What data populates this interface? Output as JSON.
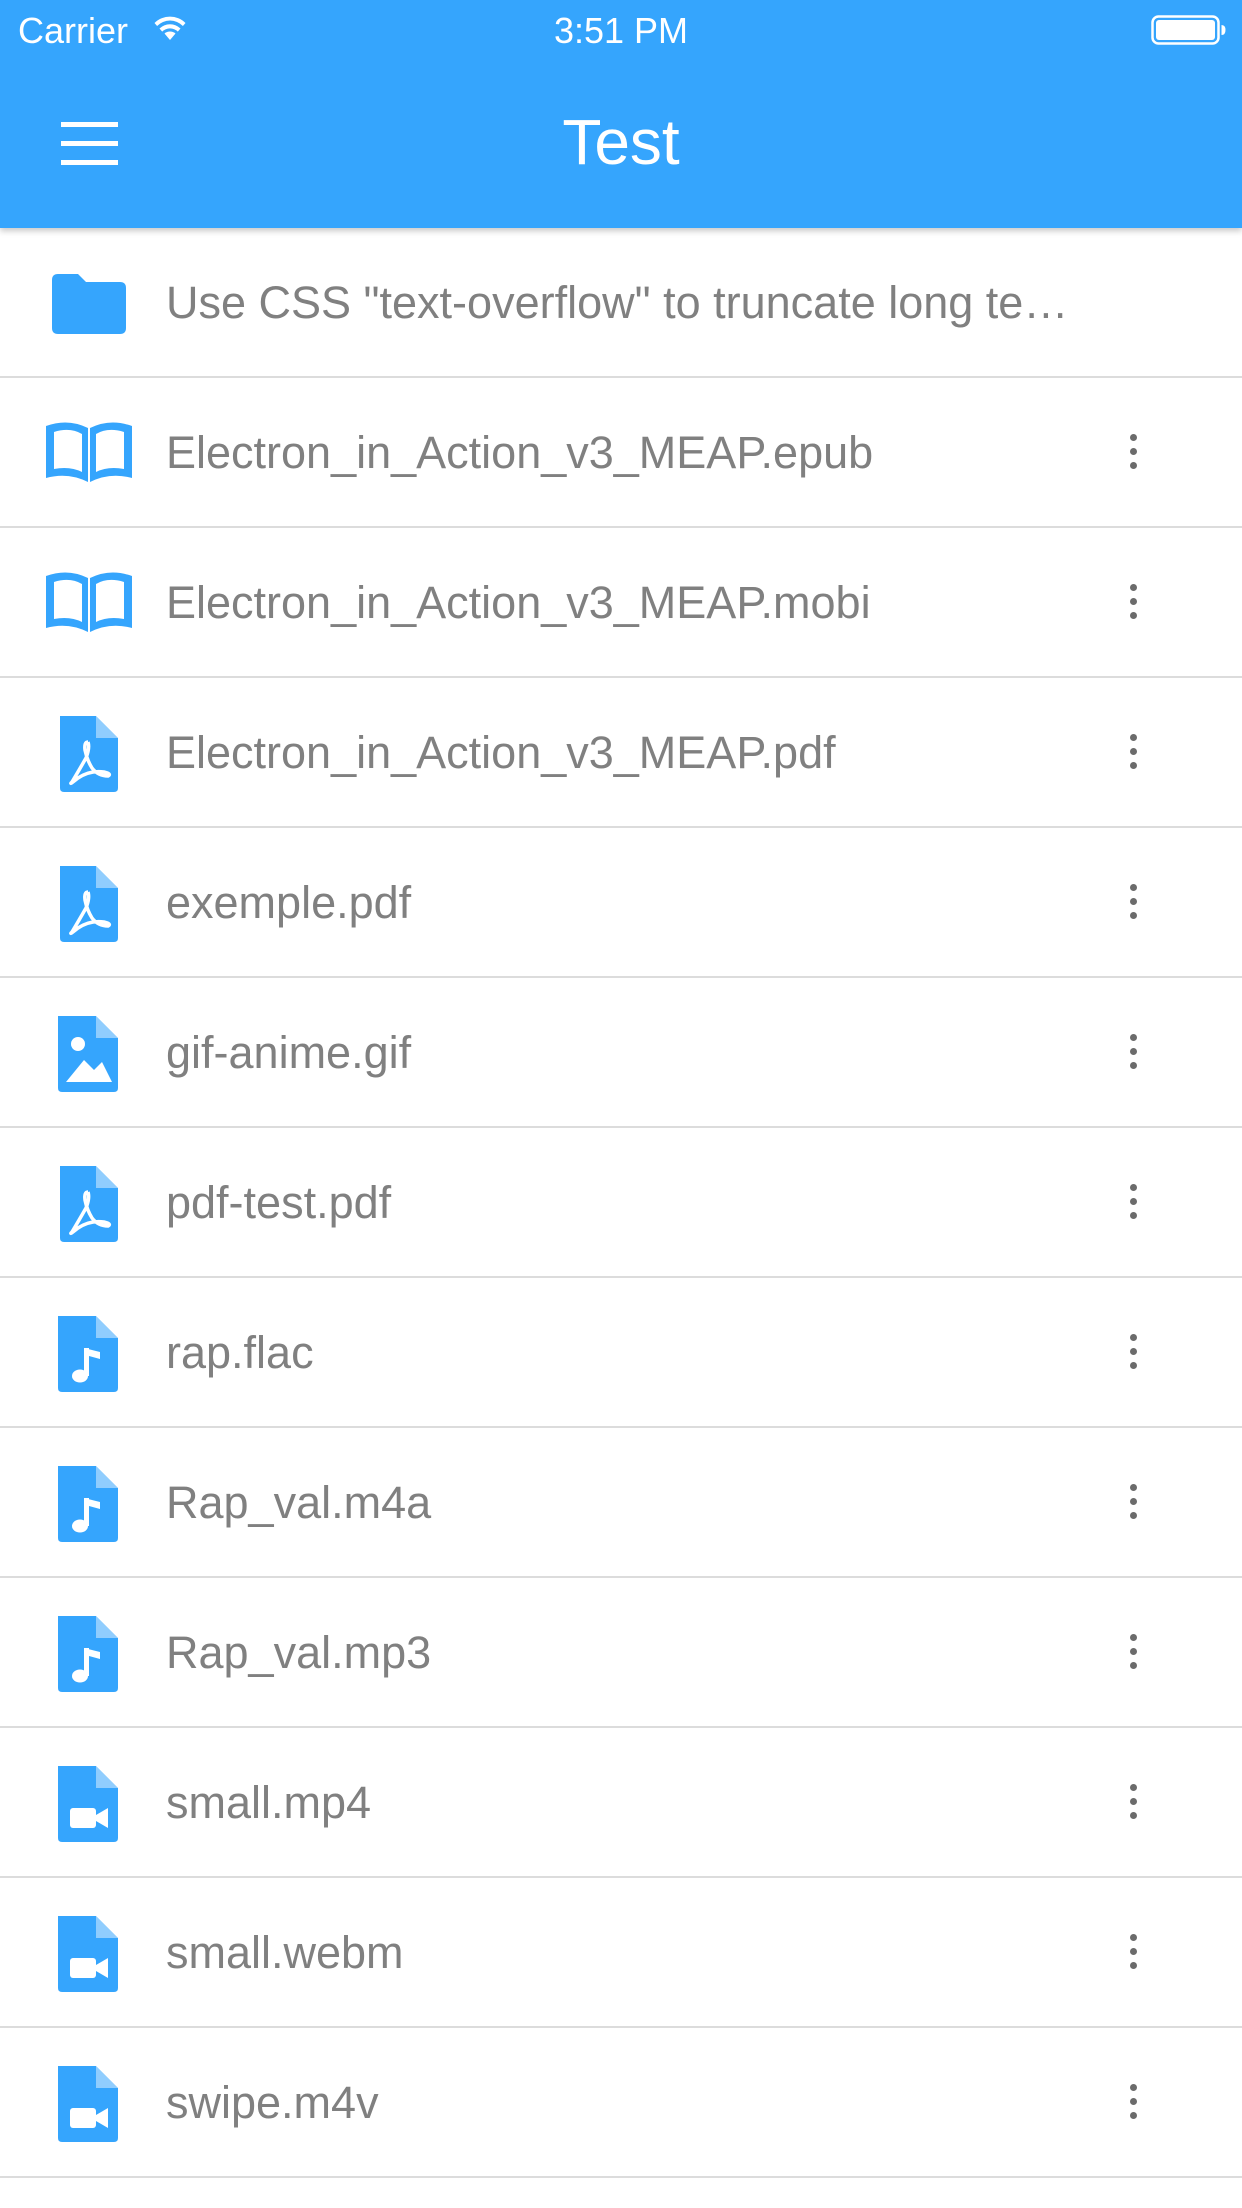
{
  "status_bar": {
    "carrier": "Carrier",
    "time": "3:51 PM",
    "wifi_icon": "wifi-icon",
    "battery_icon": "battery-icon"
  },
  "header": {
    "title": "Test",
    "menu_icon": "hamburger-menu-icon",
    "background_color": "#35a5fd"
  },
  "colors": {
    "accent": "#35a5fd",
    "text": "#808080",
    "divider": "#dcdcdc",
    "more_icon": "#6b6b6b"
  },
  "files": {
    "items": [
      {
        "name": "Use CSS \"text-overflow\" to truncate long text lines",
        "icon": "folder-icon",
        "has_menu": false
      },
      {
        "name": "Electron_in_Action_v3_MEAP.epub",
        "icon": "book-icon",
        "has_menu": true
      },
      {
        "name": "Electron_in_Action_v3_MEAP.mobi",
        "icon": "book-icon",
        "has_menu": true
      },
      {
        "name": "Electron_in_Action_v3_MEAP.pdf",
        "icon": "pdf-file-icon",
        "has_menu": true
      },
      {
        "name": "exemple.pdf",
        "icon": "pdf-file-icon",
        "has_menu": true
      },
      {
        "name": "gif-anime.gif",
        "icon": "image-file-icon",
        "has_menu": true
      },
      {
        "name": "pdf-test.pdf",
        "icon": "pdf-file-icon",
        "has_menu": true
      },
      {
        "name": "rap.flac",
        "icon": "audio-file-icon",
        "has_menu": true
      },
      {
        "name": "Rap_val.m4a",
        "icon": "audio-file-icon",
        "has_menu": true
      },
      {
        "name": "Rap_val.mp3",
        "icon": "audio-file-icon",
        "has_menu": true
      },
      {
        "name": "small.mp4",
        "icon": "video-file-icon",
        "has_menu": true
      },
      {
        "name": "small.webm",
        "icon": "video-file-icon",
        "has_menu": true
      },
      {
        "name": "swipe.m4v",
        "icon": "video-file-icon",
        "has_menu": true
      }
    ]
  }
}
